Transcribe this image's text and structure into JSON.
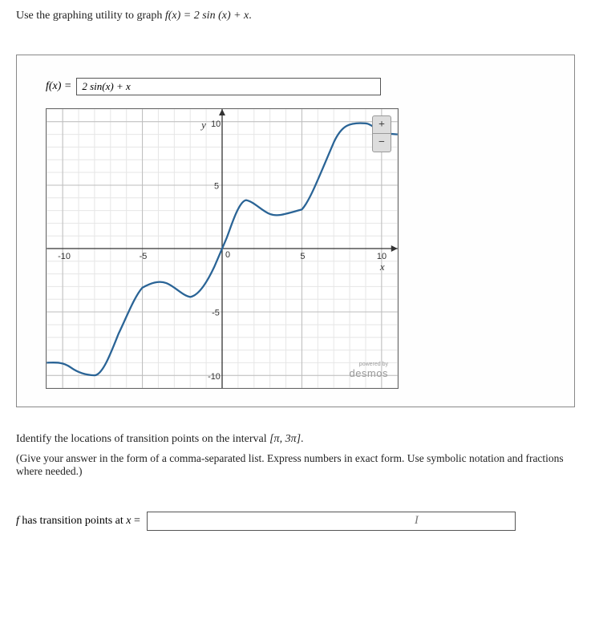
{
  "instruction": {
    "prefix": "Use the graphing utility to graph ",
    "fx": "f(x) = 2 sin (x) + x",
    "suffix": "."
  },
  "input_row": {
    "label": "f(x) =",
    "value": "2 sin(x) + x"
  },
  "graph": {
    "y_label": "y",
    "x_label": "x",
    "ticks": {
      "neg10": "-10",
      "neg5": "-5",
      "zero": "0",
      "pos5": "5",
      "pos10": "10"
    },
    "zoom": {
      "in": "+",
      "out": "−"
    },
    "badge": {
      "powered": "powered by",
      "name": "desmos"
    }
  },
  "chart_data": {
    "type": "line",
    "title": "",
    "xlabel": "x",
    "ylabel": "y",
    "xlim": [
      -11,
      11
    ],
    "ylim": [
      -11,
      11
    ],
    "x_ticks": [
      -10,
      -5,
      0,
      5,
      10
    ],
    "y_ticks": [
      -10,
      -5,
      0,
      5,
      10
    ],
    "series": [
      {
        "name": "f(x) = 2 sin(x) + x",
        "x": [
          -11,
          -10,
          -9,
          -8,
          -7,
          -6,
          -5,
          -4,
          -3,
          -2.5,
          -2,
          -1.5,
          -1,
          -0.5,
          0,
          0.5,
          1,
          1.5,
          2,
          2.5,
          3,
          4,
          5,
          6,
          7,
          8,
          9,
          10,
          11
        ],
        "values": [
          -9.0,
          -8.91,
          -9.82,
          -9.98,
          -8.31,
          -5.44,
          -3.08,
          -2.49,
          -2.72,
          -3.7,
          -3.82,
          -3.49,
          -2.68,
          -1.46,
          0.0,
          1.46,
          2.68,
          3.49,
          3.82,
          3.7,
          3.28,
          2.49,
          3.08,
          5.44,
          8.31,
          9.98,
          9.82,
          8.91,
          9.0
        ]
      }
    ]
  },
  "question2": {
    "line1_a": "Identify the locations of transition points on the interval ",
    "interval": "[π, 3π]",
    "line1_b": ".",
    "hint": "(Give your answer in the form of a comma-separated list. Express numbers in exact form. Use symbolic notation and fractions where needed.)"
  },
  "answer": {
    "label_prefix": "f has transition points at x = ",
    "value": "",
    "cursor_hint": "I"
  }
}
